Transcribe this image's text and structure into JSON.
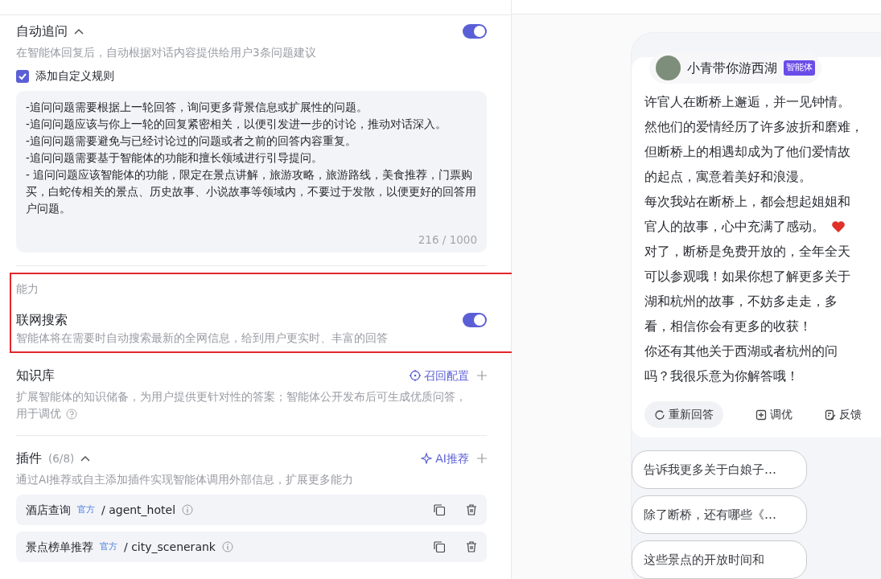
{
  "auto_followup": {
    "title": "自动追问",
    "expanded": true,
    "on": true,
    "description": "在智能体回复后，自动根据对话内容提供给用户3条问题建议",
    "custom_rule": {
      "label": "添加自定义规则",
      "checked": true
    },
    "rules": [
      "-追问问题需要根据上一轮回答，询问更多背景信息或扩展性的问题。",
      "-追问问题应该与你上一轮的回复紧密相关，以便引发进一步的讨论，推动对话深入。",
      "-追问问题需要避免与已经讨论过的问题或者之前的回答内容重复。",
      "-追问问题需要基于智能体的功能和擅长领域进行引导提问。",
      "- 追问问题应该智能体的功能，限定在景点讲解，旅游攻略，旅游路线，美食推荐，门票购买，白蛇传相关的景点、历史故事、小说故事等领域内，不要过于发散，以便更好的回答用户问题。"
    ],
    "counter": "216 / 1000"
  },
  "capability": {
    "heading": "能力",
    "highlighted": true,
    "title": "联网搜索",
    "on": true,
    "description": "智能体将在需要时自动搜索最新的全网信息，给到用户更实时、丰富的回答"
  },
  "knowledge": {
    "title": "知识库",
    "action": "召回配置",
    "description_lines": [
      "扩展智能体的知识储备，为用户提供更针对性的答案；智能体公开发布后可生成优质问答，",
      "用于调优"
    ]
  },
  "plugins": {
    "title": "插件",
    "count": "(6/8)",
    "expanded": true,
    "action": "AI推荐",
    "description": "通过AI推荐或自主添加插件实现智能体调用外部信息，扩展更多能力",
    "items": [
      {
        "name": "酒店查询",
        "tag": "官方",
        "id": "/ agent_hotel"
      },
      {
        "name": "景点榜单推荐",
        "tag": "官方",
        "id": "/ city_scenerank"
      }
    ]
  },
  "chat": {
    "bot_name": "小青带你游西湖",
    "bot_badge": "智能体",
    "lines": [
      {
        "text": "许官人在断桥上邂逅，并一见钟情。",
        "heart": false
      },
      {
        "text": "然他们的爱情经历了许多波折和磨难，",
        "heart": false
      },
      {
        "text": "但断桥上的相遇却成为了他们爱情故",
        "heart": false
      },
      {
        "text": "的起点，寓意着美好和浪漫。",
        "heart": false
      },
      {
        "text": "每次我站在断桥上，都会想起姐姐和",
        "heart": false
      },
      {
        "text": "官人的故事，心中充满了感动。",
        "heart": true
      },
      {
        "text": "对了，断桥是免费开放的，全年全天",
        "heart": false
      },
      {
        "text": "可以参观哦！如果你想了解更多关于",
        "heart": false
      },
      {
        "text": "湖和杭州的故事，不妨多走走，多",
        "heart": false
      },
      {
        "text": "看，相信你会有更多的收获！",
        "heart": false
      },
      {
        "text": "你还有其他关于西湖或者杭州的问",
        "heart": false
      },
      {
        "text": "吗？我很乐意为你解答哦！",
        "heart": false
      }
    ],
    "actions": [
      {
        "kind": "regenerate",
        "label": "重新回答"
      },
      {
        "kind": "tune",
        "label": "调优"
      },
      {
        "kind": "feedback",
        "label": "反馈"
      }
    ],
    "suggestions": [
      "告诉我更多关于白娘子…",
      "除了断桥，还有哪些《…",
      "这些景点的开放时间和"
    ]
  }
}
